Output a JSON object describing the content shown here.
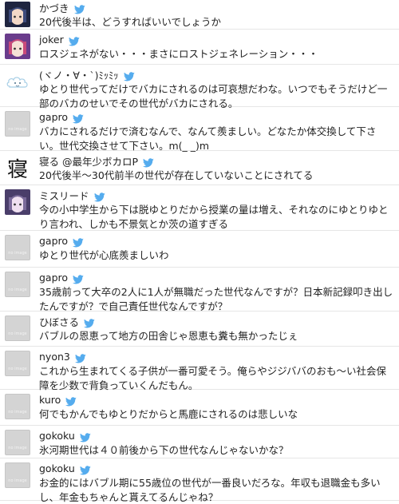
{
  "tweets": [
    {
      "name": "かづき",
      "text": "20代後半は、どうすればいいでしょうか",
      "avatar": "anime-avatar-1"
    },
    {
      "name": "joker",
      "text": "ロスジェネがない・・・まさにロストジェネレーション・・・",
      "avatar": "anime-avatar-2"
    },
    {
      "name": "(ヾノ・∀・`)ﾐｯﾐｯ",
      "text": "ゆとり世代ってだけでバカにされるのは可哀想だわな。いつでもそうだけど一部のバカのせいでその世代がバカにされる。",
      "avatar": "cloud-avatar"
    },
    {
      "name": "gapro",
      "text": "バカにされるだけで済むなんで、なんて羨ましい。どなたか体交換して下さい。世代交換させて下さい。m(_ _)m",
      "avatar": "no-image"
    },
    {
      "name": "寝る @最年少ボカロP",
      "text": "20代後半〜30代前半の世代が存在していないことにされてる",
      "avatar": "kanji",
      "avatar_char": "寝"
    },
    {
      "name": "ミスリード",
      "text": "今の小中学生から下は脱ゆとりだから授業の量は増え、それなのにゆとりゆとり言われ、しかも不景気とか茨の道すぎる",
      "avatar": "anime-avatar-3"
    },
    {
      "name": "gapro",
      "text": "ゆとり世代が心底羨ましいわ",
      "avatar": "no-image"
    },
    {
      "name": "gapro",
      "text": "35歳前って大卒の2人に1人が無職だった世代なんですが？日本新記録叩き出したんですが？で自己責任世代なんですが？",
      "avatar": "no-image"
    },
    {
      "name": "ひぼさる",
      "text": "バブルの恩恵って地方の田舎じゃ恩恵も糞も無かったじぇ",
      "avatar": "no-image"
    },
    {
      "name": "nyon3",
      "text": "これから生まれてくる子供が一番可愛そう。俺らやジジババのおも〜い社会保障を少数で背負っていくんだもん。",
      "avatar": "no-image"
    },
    {
      "name": "kuro",
      "text": "何でもかんでもゆとりだからと馬鹿にされるのは悲しいな",
      "avatar": "no-image"
    },
    {
      "name": "gokoku",
      "text": "氷河期世代は４０前後から下の世代なんじゃないかな？",
      "avatar": "no-image"
    },
    {
      "name": "gokoku",
      "text": "お金的にはバブル期に55歳位の世代が一番良いだろな。年収も退職金も多いし、年金もちゃんと貰えてるんじゃね？",
      "avatar": "no-image"
    }
  ],
  "no_image_label": "no image",
  "colors": {
    "bird": "#55acee",
    "divider": "#e6e6e6",
    "text": "#222222",
    "noimage_bg": "#d4d4d4"
  }
}
